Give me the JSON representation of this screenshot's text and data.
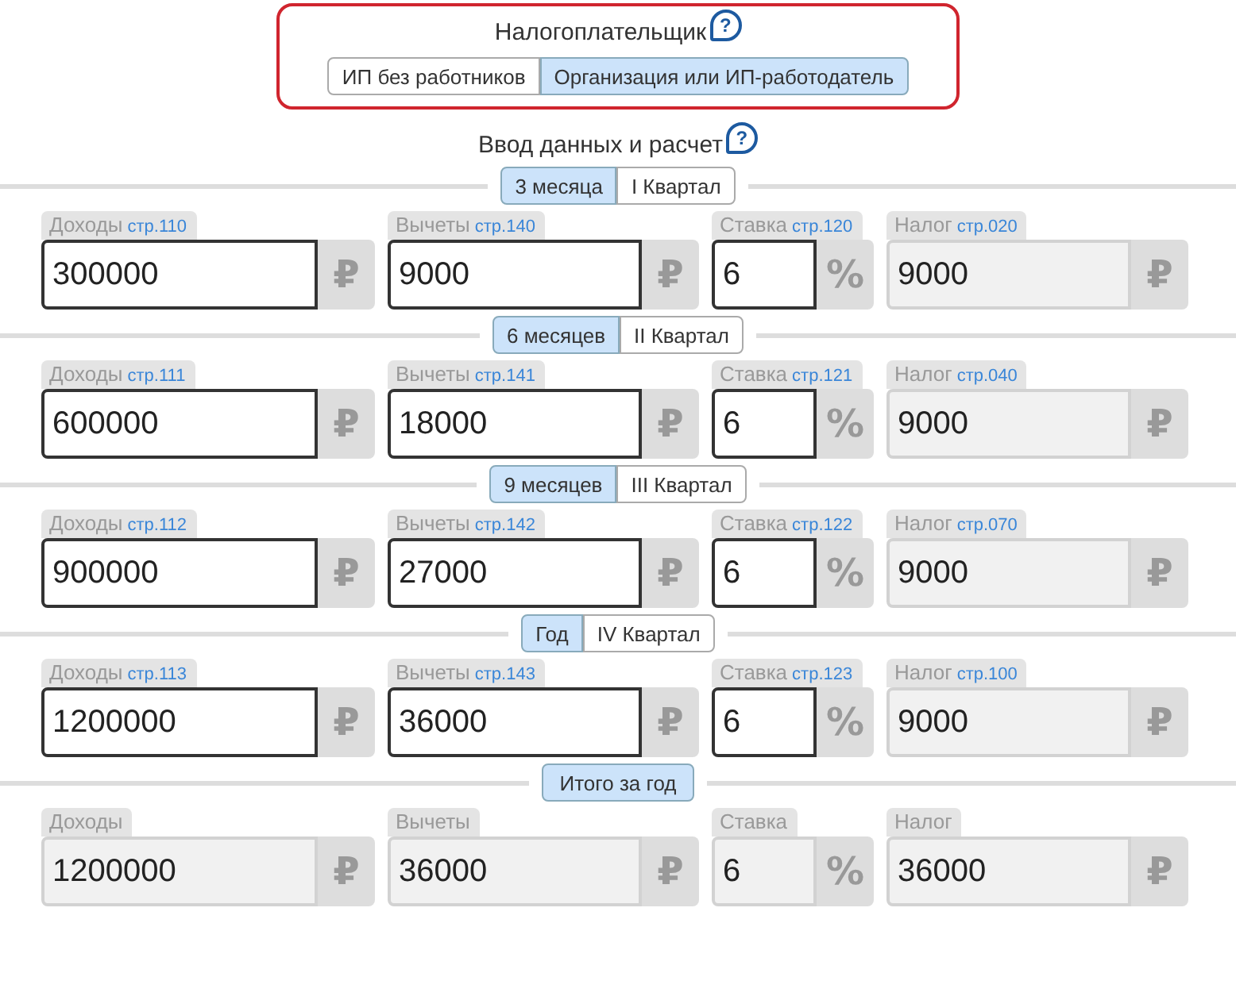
{
  "taxpayer": {
    "title": "Налогоплательщик",
    "help": "?",
    "options": [
      {
        "label": "ИП без работников",
        "selected": false
      },
      {
        "label": "Организация или ИП-работодатель",
        "selected": true
      }
    ]
  },
  "input_section": {
    "title": "Ввод данных и расчет",
    "help": "?"
  },
  "periods": [
    {
      "tabs": [
        {
          "label": "3 месяца",
          "selected": true
        },
        {
          "label": "I Квартал",
          "selected": false
        }
      ],
      "fields": [
        {
          "label": "Доходы",
          "line": "стр.110",
          "value": "300000",
          "unit": "₽",
          "kind": "input"
        },
        {
          "label": "Вычеты",
          "line": "стр.140",
          "value": "9000",
          "unit": "₽",
          "kind": "input"
        },
        {
          "label": "Ставка",
          "line": "стр.120",
          "value": "6",
          "unit": "%",
          "kind": "input"
        },
        {
          "label": "Налог",
          "line": "стр.020",
          "value": "9000",
          "unit": "₽",
          "kind": "readonly"
        }
      ]
    },
    {
      "tabs": [
        {
          "label": "6 месяцев",
          "selected": true
        },
        {
          "label": "II Квартал",
          "selected": false
        }
      ],
      "fields": [
        {
          "label": "Доходы",
          "line": "стр.111",
          "value": "600000",
          "unit": "₽",
          "kind": "input"
        },
        {
          "label": "Вычеты",
          "line": "стр.141",
          "value": "18000",
          "unit": "₽",
          "kind": "input"
        },
        {
          "label": "Ставка",
          "line": "стр.121",
          "value": "6",
          "unit": "%",
          "kind": "input"
        },
        {
          "label": "Налог",
          "line": "стр.040",
          "value": "9000",
          "unit": "₽",
          "kind": "readonly"
        }
      ]
    },
    {
      "tabs": [
        {
          "label": "9 месяцев",
          "selected": true
        },
        {
          "label": "III Квартал",
          "selected": false
        }
      ],
      "fields": [
        {
          "label": "Доходы",
          "line": "стр.112",
          "value": "900000",
          "unit": "₽",
          "kind": "input"
        },
        {
          "label": "Вычеты",
          "line": "стр.142",
          "value": "27000",
          "unit": "₽",
          "kind": "input"
        },
        {
          "label": "Ставка",
          "line": "стр.122",
          "value": "6",
          "unit": "%",
          "kind": "input"
        },
        {
          "label": "Налог",
          "line": "стр.070",
          "value": "9000",
          "unit": "₽",
          "kind": "readonly"
        }
      ]
    },
    {
      "tabs": [
        {
          "label": "Год",
          "selected": true
        },
        {
          "label": "IV Квартал",
          "selected": false
        }
      ],
      "fields": [
        {
          "label": "Доходы",
          "line": "стр.113",
          "value": "1200000",
          "unit": "₽",
          "kind": "input"
        },
        {
          "label": "Вычеты",
          "line": "стр.143",
          "value": "36000",
          "unit": "₽",
          "kind": "input"
        },
        {
          "label": "Ставка",
          "line": "стр.123",
          "value": "6",
          "unit": "%",
          "kind": "input"
        },
        {
          "label": "Налог",
          "line": "стр.100",
          "value": "9000",
          "unit": "₽",
          "kind": "readonly"
        }
      ]
    },
    {
      "tabs": [
        {
          "label": "Итого за год",
          "selected": true
        }
      ],
      "fields": [
        {
          "label": "Доходы",
          "value": "1200000",
          "unit": "₽",
          "kind": "readonly"
        },
        {
          "label": "Вычеты",
          "value": "36000",
          "unit": "₽",
          "kind": "readonly"
        },
        {
          "label": "Ставка",
          "value": "6",
          "unit": "%",
          "kind": "readonly"
        },
        {
          "label": "Налог",
          "value": "36000",
          "unit": "₽",
          "kind": "readonly"
        }
      ]
    }
  ]
}
